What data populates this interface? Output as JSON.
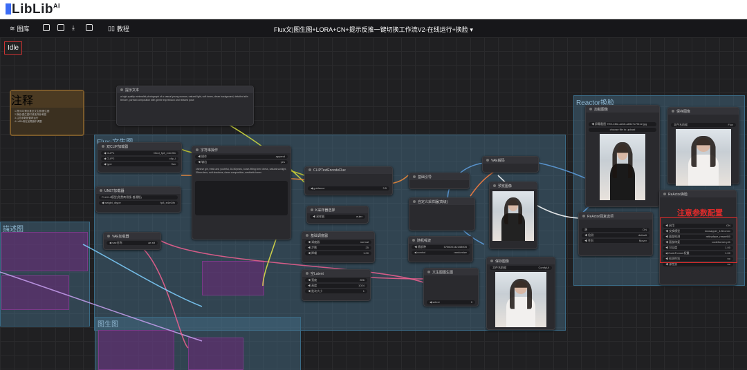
{
  "app": {
    "brand": "LibLib",
    "brand_sup": "AI"
  },
  "toolbar": {
    "gallery": "图库",
    "tutorial": "教程",
    "workflow_title": "Flux文|图生图+LORA+CN+提示反推一键切换工作流V2-在线运行+换脸 ▾"
  },
  "status": "Idle",
  "groups": {
    "flux": "Flux-文生图",
    "reactor": "Reactor换脸",
    "left": "描述图",
    "bottom": "图生图"
  },
  "nodes": {
    "note": "注释",
    "prompt_text": "提示文本",
    "dual_clip": "双CLIP加载器",
    "vae_loader": "VAE加载器",
    "unet_loader": "UNET加载器",
    "string_op": "字符串操作",
    "clip_text_encode": "CLIPTextEncodeFlux",
    "flux_guidance": "基础引导",
    "k_sampler": "K采样器选择",
    "custom_sampler": "自定义采样器(高级)",
    "basic_scheduler": "基础调度器",
    "random_noise": "随机噪波",
    "latent": "空Latent",
    "latent_switch": "文生图图生图",
    "vae_decode": "VAE解码",
    "preview": "预览图像",
    "load_image": "加载图像",
    "save_image": "保存图像",
    "reactor": "ReActor换脸",
    "reactor_opts": "ReActor回复选项",
    "save_image2": "保存图像"
  },
  "widgets": {
    "clip1": "t5xxl_fp8_e4m3fn",
    "clip2": "clip_l",
    "clip_type": "flux",
    "unet": "FLUX-4模型(免费商用版-普通版)",
    "weight": "fp8_e4m3fn",
    "sampler": "euler",
    "scheduler": "normal",
    "steps": "25",
    "denoise": "1.00",
    "seed": "575600142158005",
    "control": "randomize",
    "width": "896",
    "height": "1024",
    "batch": "1",
    "guidance": "3.5",
    "vae": "ae.sft",
    "select": "0",
    "load_file": "◀ 屏幕截图 7f92-4f8e-aeb6-a65e7c7f412.jpg",
    "choose_file": "choose file to upload",
    "file_prefix": "ComfyUI",
    "swap": "ON",
    "face_model": "inswapper_128.onnx",
    "restore": "retinaface_resnet50",
    "restore_model": "codeformer.pth",
    "detect": "default",
    "gender": "Mover",
    "v1": "1.00",
    "v2": "1.00",
    "v3": "no",
    "v4": "no"
  },
  "annotation": "注意参数配置"
}
